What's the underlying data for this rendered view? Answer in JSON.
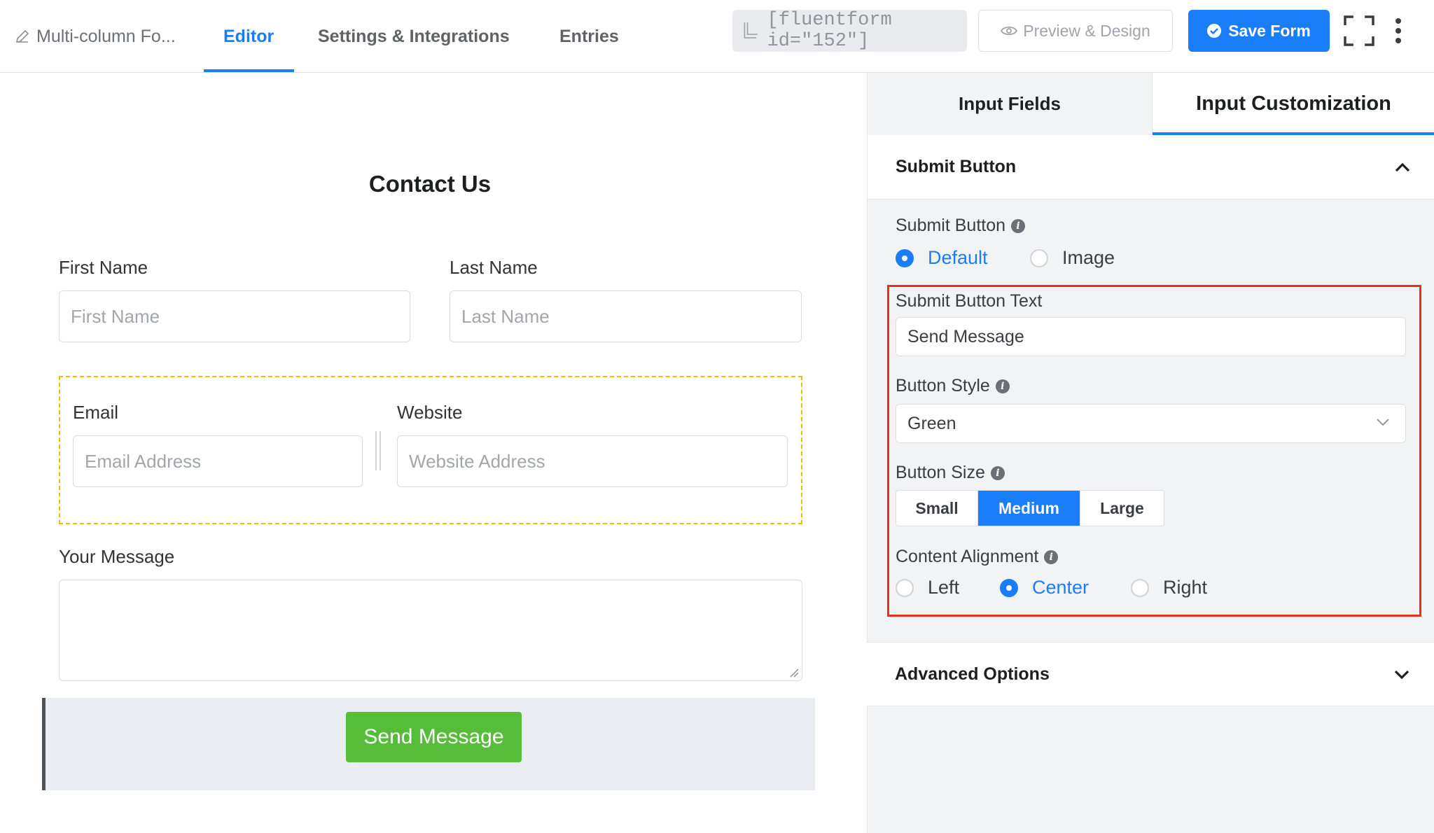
{
  "topbar": {
    "form_name": "Multi-column Fo...",
    "tabs": [
      {
        "label": "Editor",
        "active": true
      },
      {
        "label": "Settings & Integrations",
        "active": false
      },
      {
        "label": "Entries",
        "active": false
      }
    ],
    "shortcode": "[fluentform id=\"152\"]",
    "preview_label": "Preview & Design",
    "save_label": "Save Form"
  },
  "form": {
    "title": "Contact Us",
    "first_name": {
      "label": "First Name",
      "placeholder": "First Name"
    },
    "last_name": {
      "label": "Last Name",
      "placeholder": "Last Name"
    },
    "email": {
      "label": "Email",
      "placeholder": "Email Address"
    },
    "website": {
      "label": "Website",
      "placeholder": "Website Address"
    },
    "message": {
      "label": "Your Message"
    },
    "submit_label": "Send Message"
  },
  "panel": {
    "tabs": [
      {
        "label": "Input Fields",
        "active": false
      },
      {
        "label": "Input Customization",
        "active": true
      }
    ],
    "section_title": "Submit Button",
    "submit_button": {
      "label": "Submit Button",
      "options": [
        "Default",
        "Image"
      ],
      "selected": "Default"
    },
    "submit_text": {
      "label": "Submit Button Text",
      "value": "Send Message"
    },
    "button_style": {
      "label": "Button Style",
      "value": "Green"
    },
    "button_size": {
      "label": "Button Size",
      "options": [
        "Small",
        "Medium",
        "Large"
      ],
      "selected": "Medium"
    },
    "alignment": {
      "label": "Content Alignment",
      "options": [
        "Left",
        "Center",
        "Right"
      ],
      "selected": "Center"
    },
    "advanced_title": "Advanced Options"
  },
  "colors": {
    "accent": "#1a7efb",
    "submit_green": "#56bd39",
    "highlight_red": "#e8301f",
    "group_dashed": "#e5c100"
  }
}
